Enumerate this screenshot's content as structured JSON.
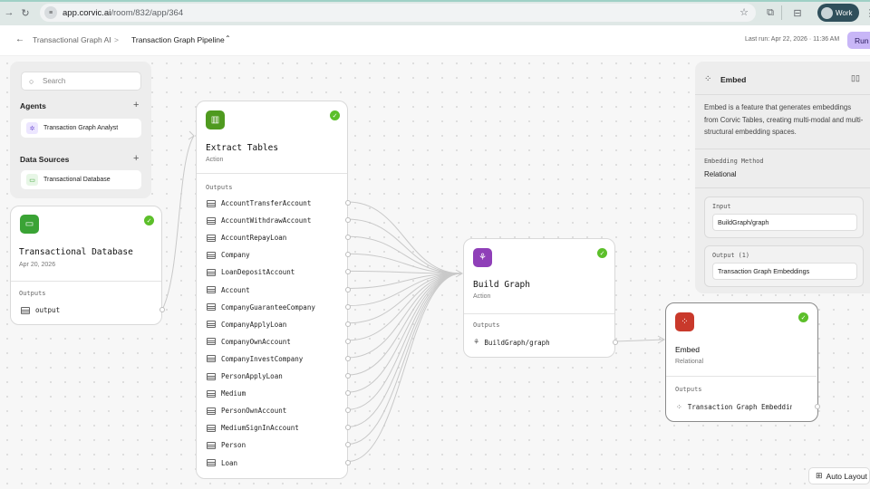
{
  "browser": {
    "url_host": "app.corvic.ai",
    "url_path": "/room/832/app/364",
    "profile_label": "Work"
  },
  "header": {
    "back_icon": "arrow-left-icon",
    "breadcrumb_parent": "Transactional Graph AI",
    "breadcrumb_separator": ">",
    "pipeline_name": "Transaction Graph Pipeline",
    "last_run": "Last run: Apr 22, 2026 · 11:36 AM",
    "run_label": "Run"
  },
  "sidebar": {
    "search_placeholder": "Search",
    "agents_heading": "Agents",
    "agents": [
      {
        "label": "Transaction Graph Analyst",
        "icon": "agent-icon"
      }
    ],
    "data_sources_heading": "Data Sources",
    "data_sources": [
      {
        "label": "Transactional Database",
        "icon": "monitor-icon"
      }
    ]
  },
  "nodes": {
    "database": {
      "title": "Transactional Database",
      "subtitle": "Apr 20, 2026",
      "outputs_label": "Outputs",
      "outputs": [
        "output"
      ],
      "color": "#3aa335"
    },
    "extract": {
      "title": "Extract Tables",
      "subtitle": "Action",
      "outputs_label": "Outputs",
      "outputs": [
        "AccountTransferAccount",
        "AccountWithdrawAccount",
        "AccountRepayLoan",
        "Company",
        "LoanDepositAccount",
        "Account",
        "CompanyGuaranteeCompany",
        "CompanyApplyLoan",
        "CompanyOwnAccount",
        "CompanyInvestCompany",
        "PersonApplyLoan",
        "Medium",
        "PersonOwnAccount",
        "MediumSignInAccount",
        "Person",
        "Loan"
      ],
      "color": "#4f9a1f"
    },
    "build": {
      "title": "Build Graph",
      "subtitle": "Action",
      "outputs_label": "Outputs",
      "outputs": [
        "BuildGraph/graph"
      ],
      "color": "#8f3fb8"
    },
    "embed": {
      "title": "Embed",
      "subtitle": "Relational",
      "outputs_label": "Outputs",
      "outputs": [
        "Transaction Graph Embedding"
      ],
      "color": "#c9392b"
    }
  },
  "inspector": {
    "title": "Embed",
    "description": "Embed is a feature that generates embeddings from Corvic Tables, creating multi-modal and multi-structural embedding spaces.",
    "method_label": "Embedding Method",
    "method_value": "Relational",
    "input_label": "Input",
    "input_value": "BuildGraph/graph",
    "output_label": "Output (1)",
    "output_value": "Transaction Graph Embeddings"
  },
  "canvas": {
    "auto_layout_label": "Auto Layout",
    "status_color": "#5cbf2a"
  }
}
